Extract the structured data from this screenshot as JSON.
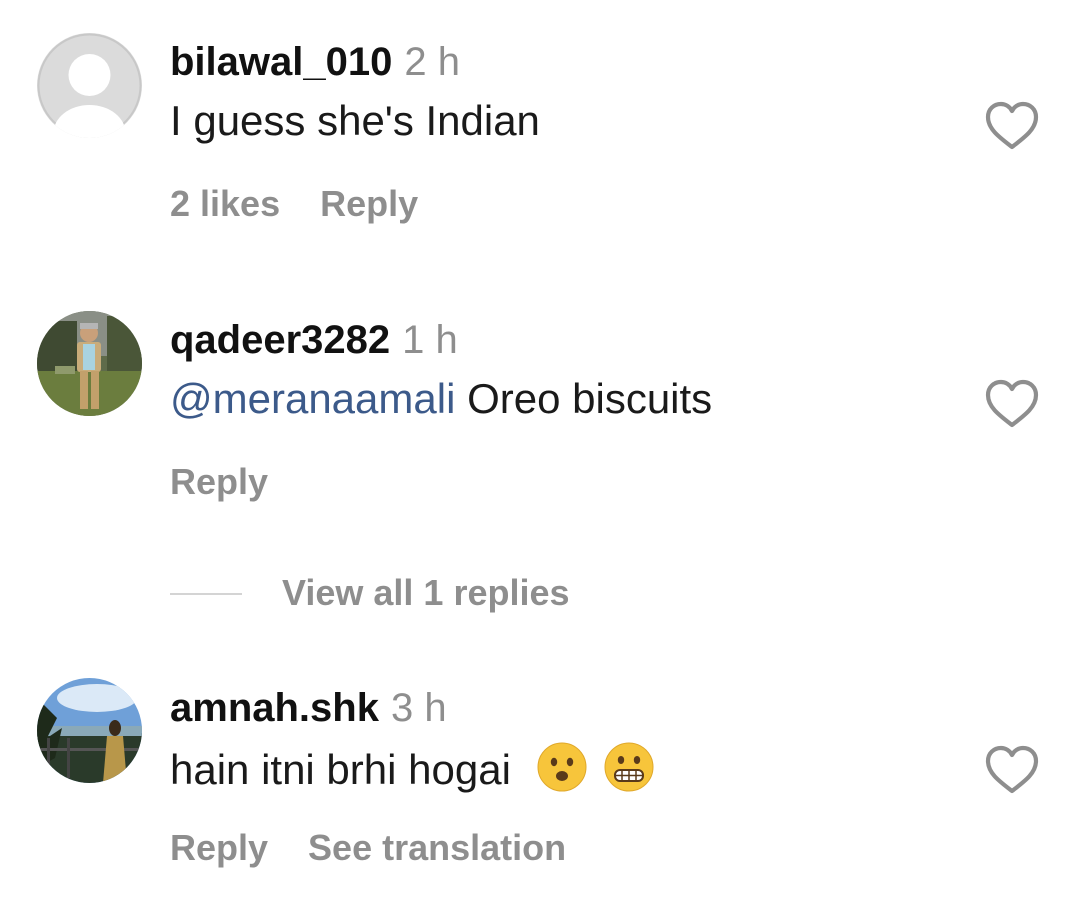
{
  "comments": [
    {
      "username": "bilawal_010",
      "time": "2 h",
      "mention": "",
      "text": "I guess she's Indian",
      "likes": "2 likes",
      "reply": "Reply",
      "avatar": "default-avatar"
    },
    {
      "username": "qadeer3282",
      "time": "1 h",
      "mention": "@meranaamali",
      "text": " Oreo biscuits",
      "reply": "Reply",
      "avatar": "photo-avatar"
    },
    {
      "username": "amnah.shk",
      "time": "3 h",
      "mention": "",
      "text": "hain itni brhi hogai",
      "emojis": [
        "frowning-face-open-mouth-emoji",
        "grimacing-face-emoji"
      ],
      "reply": "Reply",
      "translate": "See translation",
      "avatar": "photo-avatar"
    }
  ],
  "view_replies": "View all 1 replies",
  "colors": {
    "secondary_text": "#8e8e8e",
    "mention": "#3c5a8a",
    "heart_outline": "#8e8e8e"
  },
  "icons": {
    "like": "heart-outline-icon"
  }
}
